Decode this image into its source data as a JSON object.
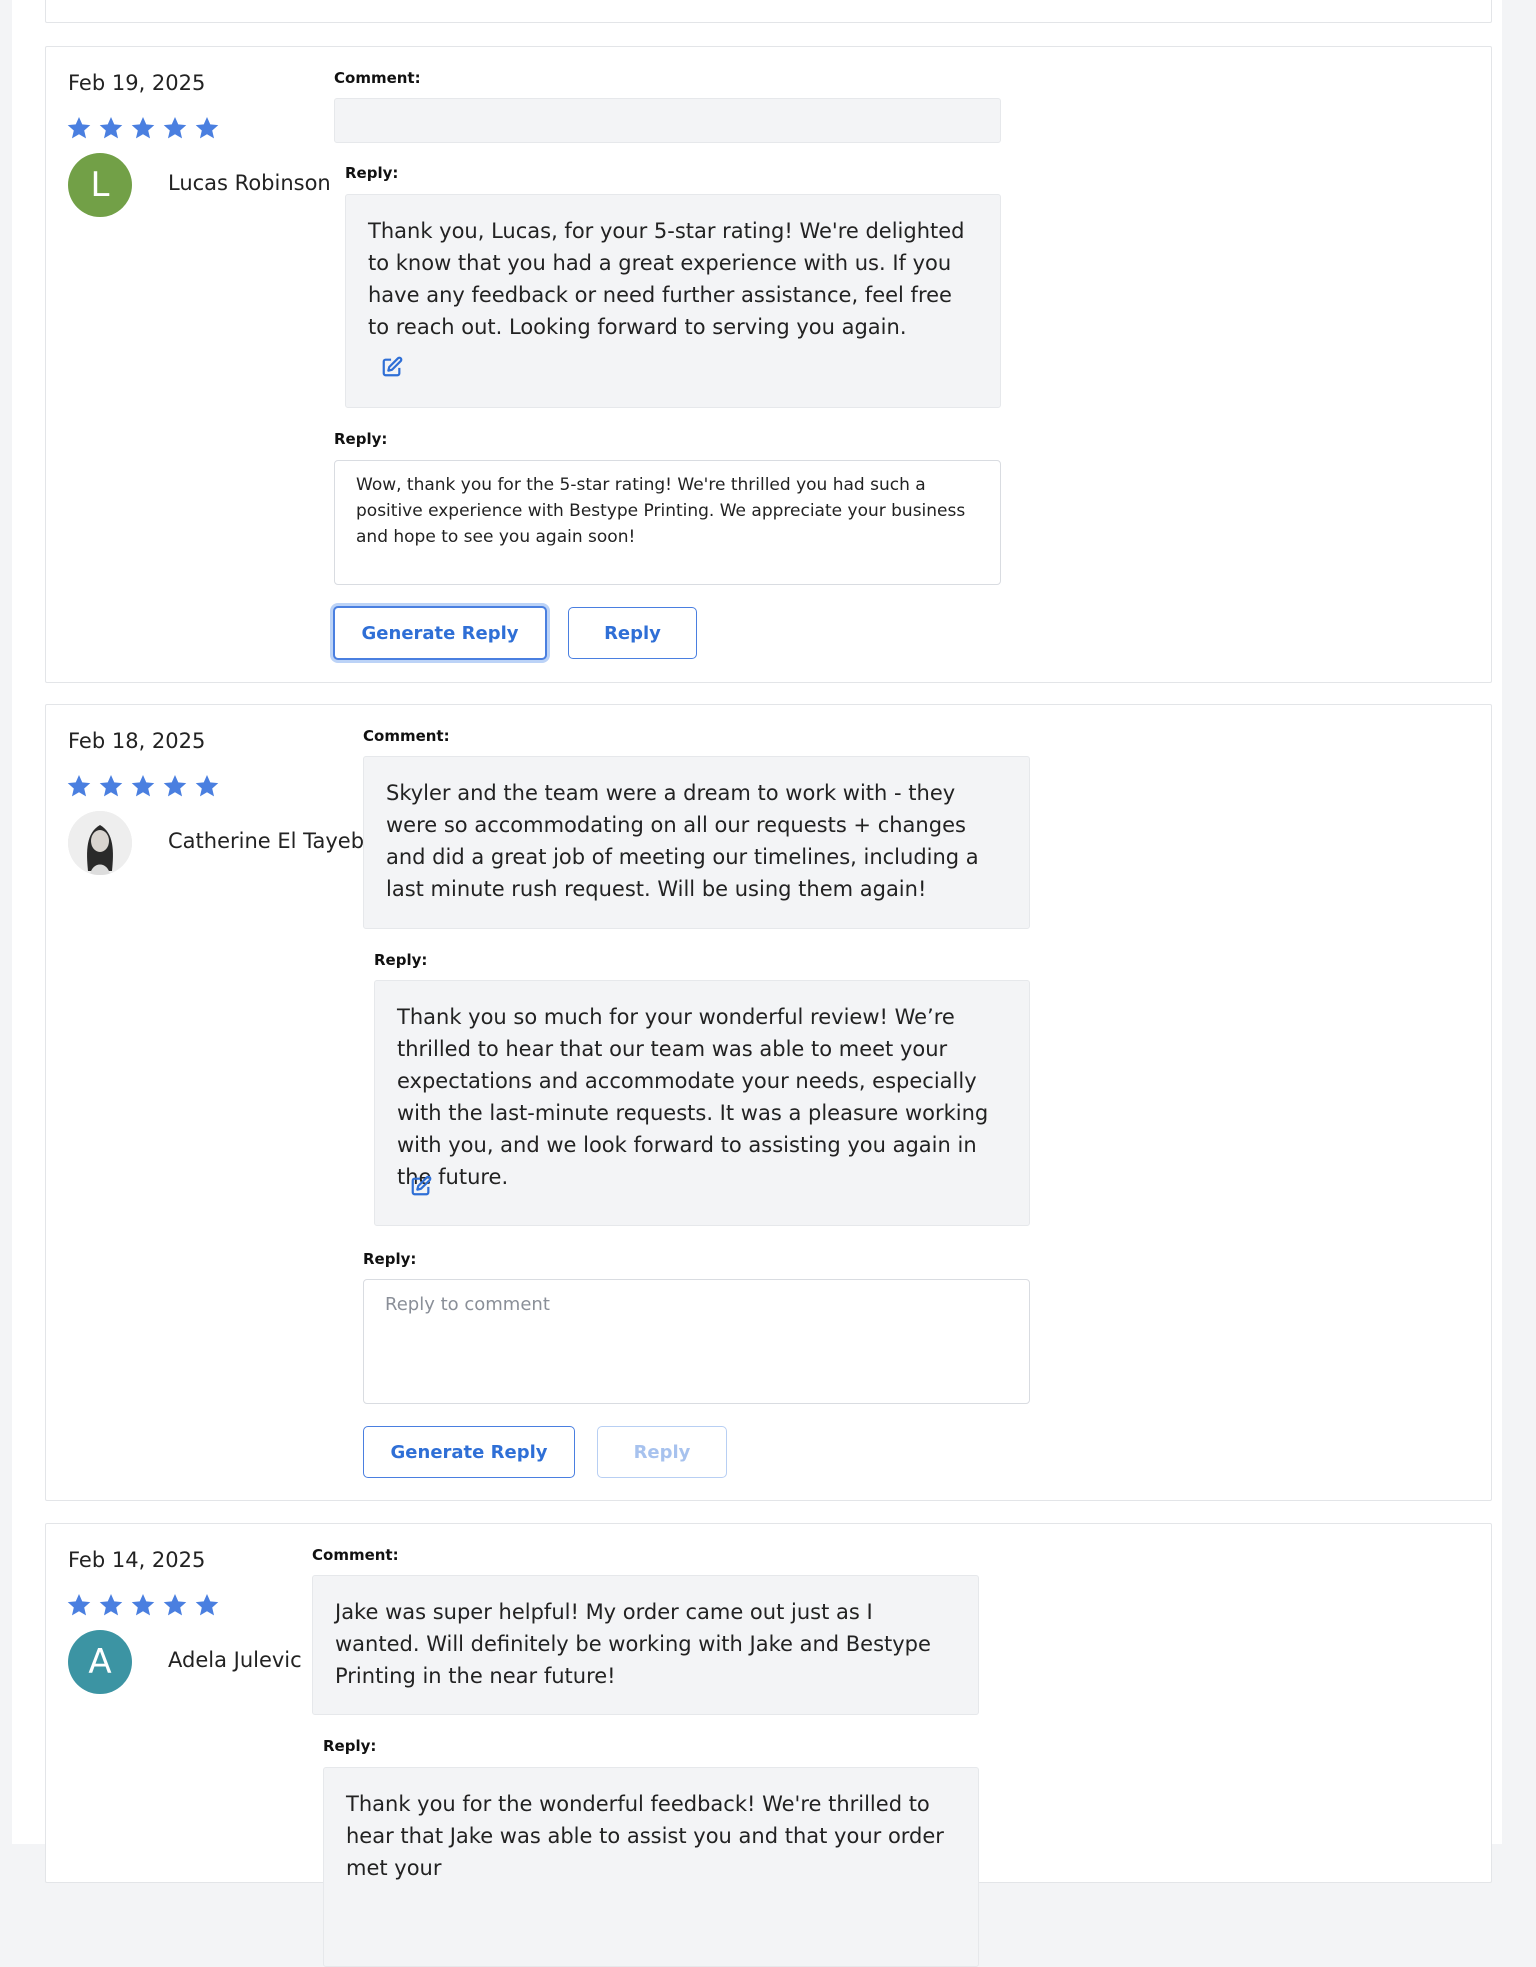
{
  "colors": {
    "accent": "#4a7fe0",
    "star": "#4a7fe0",
    "avatar_l": "#72a047",
    "avatar_a": "#3c94a3"
  },
  "labels": {
    "comment": "Comment:",
    "reply": "Reply:"
  },
  "reviews": [
    {
      "date": "Feb 19, 2025",
      "rating": 5,
      "avatar_letter": "L",
      "name": "Lucas Robinson",
      "comment": "",
      "existing_reply": "Thank you, Lucas, for your 5-star rating! We're delighted to know that you had a great experience with us. If you have any feedback or need further assistance, feel free to reach out. Looking forward to serving you again.",
      "reply_input": "Wow, thank you for the 5-star rating! We're thrilled you had such a positive experience with Bestype Printing.  We appreciate your business and hope to see you again soon!",
      "generate_label": "Generate Reply",
      "reply_label": "Reply"
    },
    {
      "date": "Feb 18, 2025",
      "rating": 5,
      "avatar_letter": "",
      "name": "Catherine El Tayeb",
      "comment": "Skyler and the team were a dream to work with - they were so accommodating on all our requests + changes and did a great job of meeting our timelines, including a last minute rush request. Will be using them again!",
      "existing_reply": "Thank you so much for your wonderful review! We’re thrilled to hear that our team was able to meet your expectations and accommodate your needs, especially with the last-minute requests. It was a pleasure working with you, and we look forward to assisting you again in the future.",
      "reply_placeholder": "Reply to comment",
      "generate_label": "Generate Reply",
      "reply_label": "Reply"
    },
    {
      "date": "Feb 14, 2025",
      "rating": 5,
      "avatar_letter": "A",
      "name": "Adela Julevic",
      "comment": "Jake was super helpful! My order came out just as I wanted. Will definitely be working with Jake and Bestype Printing in the near future!",
      "existing_reply": "Thank you for the wonderful feedback! We're thrilled to hear that Jake was able to assist you and that your order met your"
    }
  ]
}
